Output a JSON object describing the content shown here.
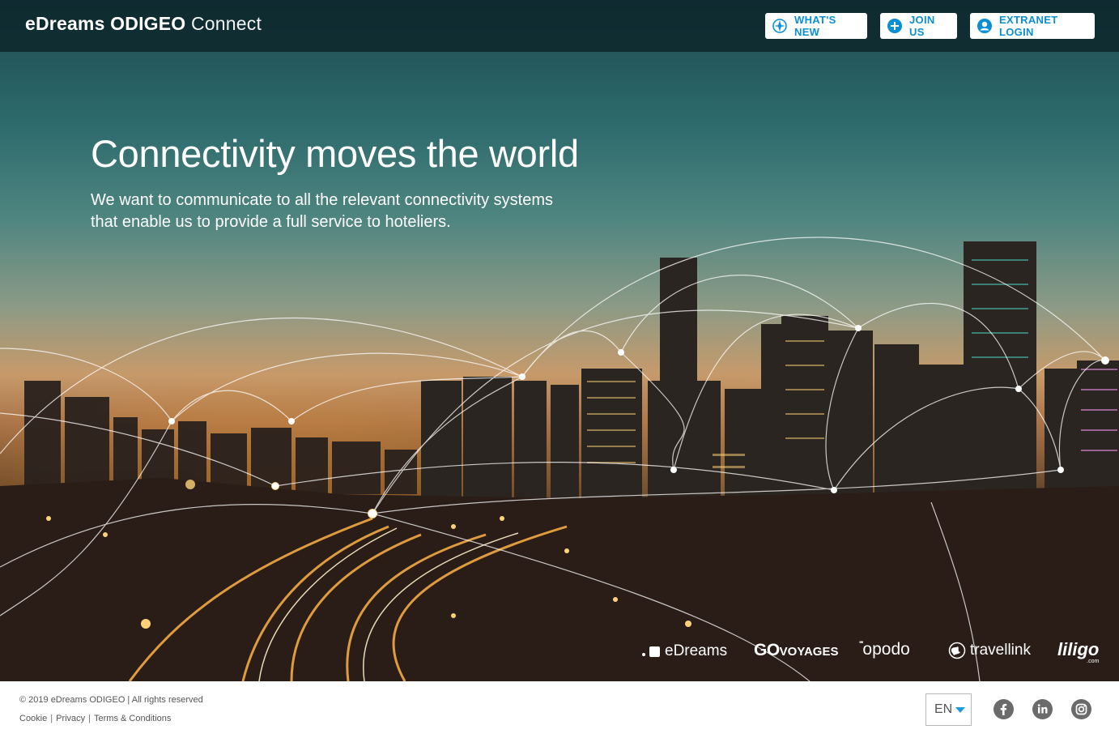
{
  "header": {
    "brand_strong": "eDreams ODIGEO",
    "brand_light": "Connect",
    "whats_new_label": "WHAT'S NEW",
    "join_us_label": "JOIN US",
    "extranet_login_label": "EXTRANET LOGIN"
  },
  "hero": {
    "title": "Connectivity moves the world",
    "subtitle_line1": "We want to communicate to all the relevant connectivity systems",
    "subtitle_line2": "that enable us to provide a full service to hoteliers."
  },
  "brands": {
    "edreams": "eDreams",
    "govoyages_go": "GO",
    "govoyages_rest": "VOYAGES",
    "opodo_dots": "''''",
    "opodo": "opodo",
    "travellink": "travellink",
    "liligo": "liligo",
    "liligo_com": ".com"
  },
  "footer": {
    "copyright": "© 2019 eDreams ODIGEO | All rights reserved",
    "links": [
      "Cookie",
      "Privacy",
      "Terms & Conditions"
    ],
    "language": "EN"
  },
  "colors": {
    "accent": "#0b8fd0",
    "header_bg": "#0c242a",
    "social_icon": "#6b6b6b"
  },
  "icons": {
    "whats_new": "compass-icon",
    "join_us": "plus-circle-icon",
    "login": "user-circle-icon",
    "facebook": "facebook-icon",
    "linkedin": "linkedin-icon",
    "instagram": "instagram-icon"
  }
}
